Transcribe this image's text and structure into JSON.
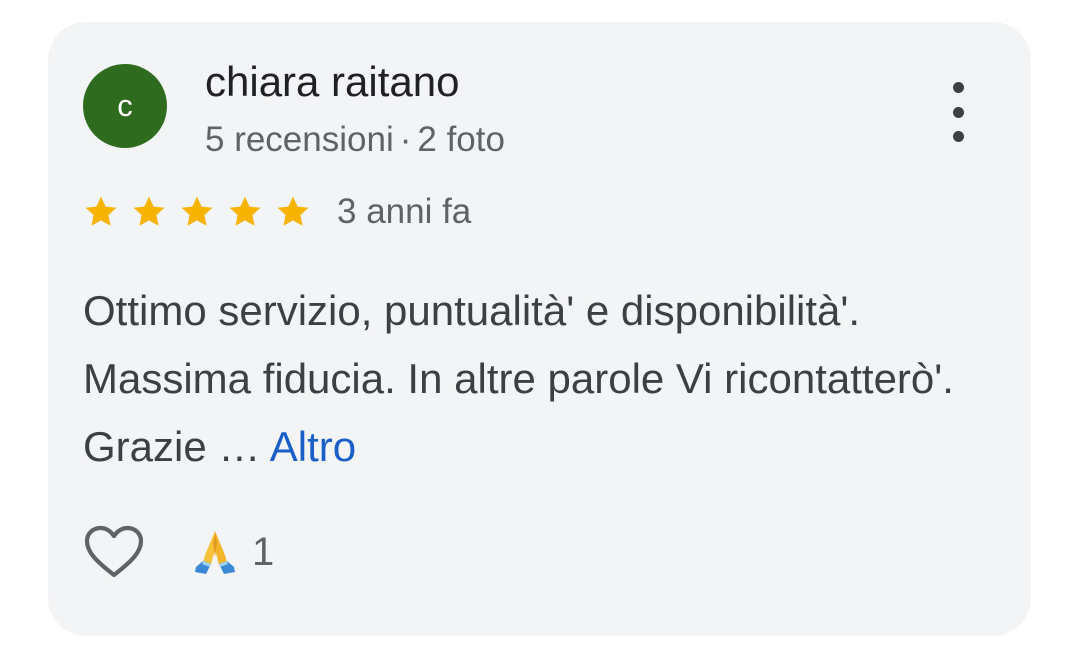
{
  "review": {
    "avatar_initial": "c",
    "avatar_color": "#2e6b1f",
    "reviewer_name": "chiara raitano",
    "review_count": "5 recensioni",
    "separator": "·",
    "photo_count": "2 foto",
    "rating": 5,
    "rating_max": 5,
    "star_color": "#f6b400",
    "time_ago": "3 anni fa",
    "text": "Ottimo servizio, puntualità' e disponibilità'. Massima fiducia. In altre parole Vi ricontatterò'. Grazie …",
    "more_label": "Altro",
    "more_link_color": "#1a5fc8",
    "menu_icon": "more-vert-icon",
    "like_icon": "heart-outline-icon",
    "reaction_icon": "folded-hands-emoji",
    "reaction_count": "1"
  }
}
